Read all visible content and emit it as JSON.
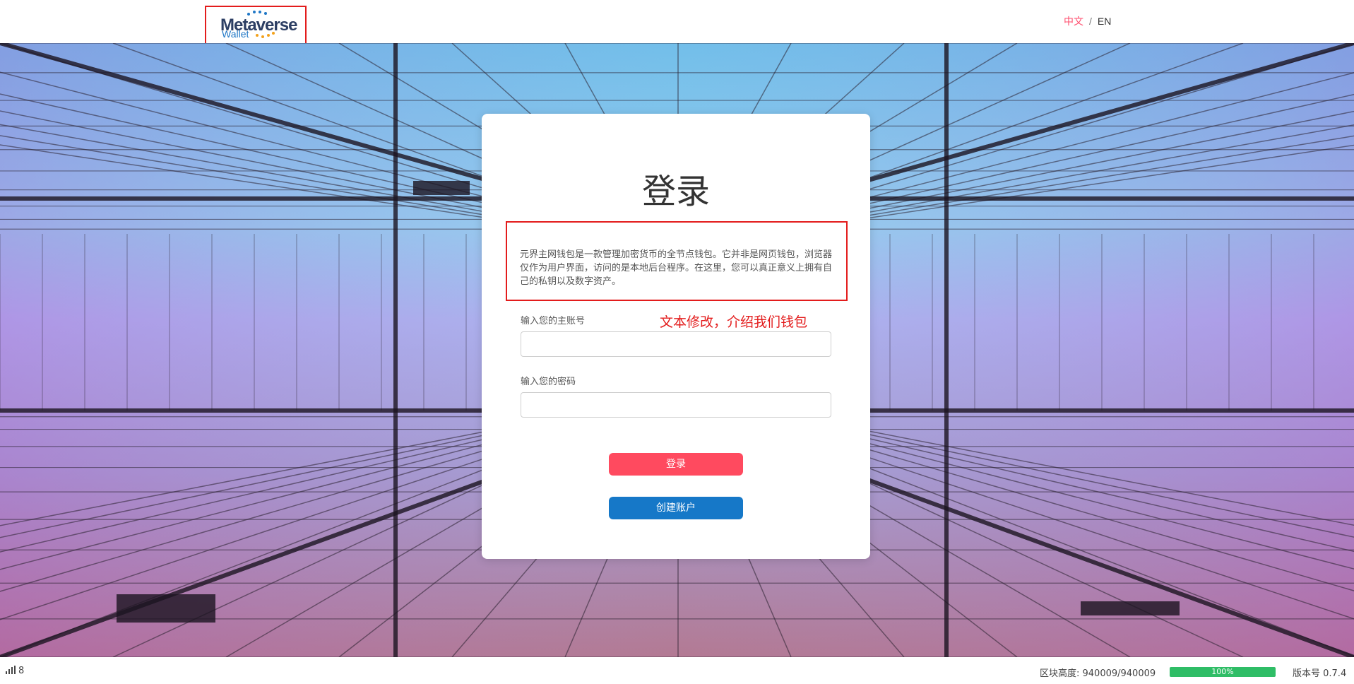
{
  "header": {
    "logo_title": "Metaverse",
    "logo_sub": "Wallet",
    "lang_zh": "中文",
    "lang_sep": "/",
    "lang_en": "EN"
  },
  "login": {
    "title": "登录",
    "description": "元界主网钱包是一款管理加密货币的全节点钱包。它并非是网页钱包，浏览器仅作为用户界面，访问的是本地后台程序。在这里，您可以真正意义上拥有自己的私钥以及数字资产。",
    "annotation": "文本修改，介绍我们钱包",
    "account_label": "输入您的主账号",
    "password_label": "输入您的密码",
    "login_button": "登录",
    "create_button": "创建账户"
  },
  "footer": {
    "peers": "8",
    "block_height_label": "区块高度: 940009/940009",
    "sync_percent": "100%",
    "version": "版本号 0.7.4"
  },
  "colors": {
    "accent_red": "#ff4a5f",
    "accent_blue": "#1678c8",
    "sync_green": "#2fbd66",
    "annotation_red": "#e31c1c"
  },
  "icons": {
    "signal": "signal-bars-icon"
  }
}
